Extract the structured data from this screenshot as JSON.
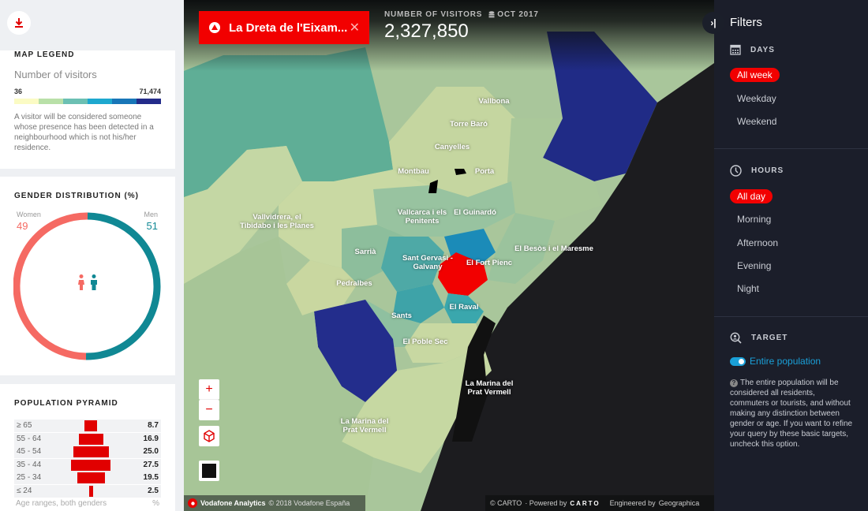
{
  "left_panel": {
    "download_icon": "download-icon",
    "legend": {
      "title": "MAP LEGEND",
      "subtitle": "Number of visitors",
      "min": "36",
      "max": "71,474",
      "colors": [
        "#fbfbc4",
        "#b9e0a8",
        "#6cc0b3",
        "#1da8cf",
        "#1876b8",
        "#232b8a"
      ],
      "note": "A visitor will be considered someone whose presence has been detected in a neighbourhood which is not his/her residence."
    },
    "gender": {
      "title": "GENDER DISTRIBUTION (%)",
      "women_label": "Women",
      "women_value": "49",
      "men_label": "Men",
      "men_value": "51",
      "women_color": "#f56a63",
      "men_color": "#108894"
    },
    "pyramid": {
      "title": "POPULATION PYRAMID",
      "rows": [
        {
          "age": "≥ 65",
          "value": "8.7"
        },
        {
          "age": "55 - 64",
          "value": "16.9"
        },
        {
          "age": "45 - 54",
          "value": "25.0"
        },
        {
          "age": "35 - 44",
          "value": "27.5"
        },
        {
          "age": "25 - 34",
          "value": "19.5"
        },
        {
          "age": "≤ 24",
          "value": "2.5"
        }
      ],
      "footer_label": "Age ranges, both genders",
      "footer_unit": "%",
      "bar_color": "#e10000"
    }
  },
  "map": {
    "selected_region": "La Dreta de l'Eixam...",
    "close_label": "✕",
    "visitors_label": "NUMBER OF VISITORS",
    "period": "OCT 2017",
    "visitors_value": "2,327,850",
    "labels": [
      {
        "text": "Vallbona"
      },
      {
        "text": "Torre Baró"
      },
      {
        "text": "Canyelles"
      },
      {
        "text": "Montbau"
      },
      {
        "text": "Porta"
      },
      {
        "text": "Vallcarca i els\nPenitents"
      },
      {
        "text": "El Guinardó"
      },
      {
        "text": "Vallvidrera, el\nTibidabo i les Planes"
      },
      {
        "text": "Sarrià"
      },
      {
        "text": "Sant Gervasi -\nGalvany"
      },
      {
        "text": "El Fort Pienc"
      },
      {
        "text": "El Besòs i el Maresme"
      },
      {
        "text": "Pedralbes"
      },
      {
        "text": "El Raval"
      },
      {
        "text": "Sants"
      },
      {
        "text": "El Poble Sec"
      },
      {
        "text": "La Marina del\nPrat Vermell"
      },
      {
        "text": "La Marina del\nPrat Vermell"
      }
    ],
    "zoom_in": "+",
    "zoom_out": "−",
    "attribution_brand": "Vodafone Analytics",
    "attribution_copy": "© 2018 Vodafone España",
    "carto_copy": "© CARTO",
    "powered_by": "· Powered by",
    "carto_logo": "CARTO",
    "engineered_by": "Engineered by",
    "engineer": "Geographica"
  },
  "filters": {
    "collapse_icon": "›|",
    "title": "Filters",
    "days": {
      "header": "DAYS",
      "options": [
        "All week",
        "Weekday",
        "Weekend"
      ],
      "selected": "All week"
    },
    "hours": {
      "header": "HOURS",
      "options": [
        "All day",
        "Morning",
        "Afternoon",
        "Evening",
        "Night"
      ],
      "selected": "All day"
    },
    "target": {
      "header": "TARGET",
      "toggle_label": "Entire population",
      "toggle_on": true,
      "note": "The entire population will be considered all residents, commuters or tourists, and without making any distinction between gender or age. If you want to refine your query by these basic targets, uncheck this option."
    }
  }
}
